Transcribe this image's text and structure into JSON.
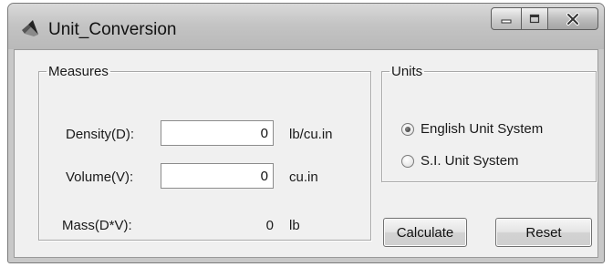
{
  "window": {
    "title": "Unit_Conversion"
  },
  "measures": {
    "legend": "Measures",
    "density": {
      "label": "Density(D):",
      "value": "0",
      "unit": "lb/cu.in"
    },
    "volume": {
      "label": "Volume(V):",
      "value": "0",
      "unit": "cu.in"
    },
    "mass": {
      "label": "Mass(D*V):",
      "value": "0",
      "unit": "lb"
    }
  },
  "units": {
    "legend": "Units",
    "options": [
      {
        "label": "English Unit System",
        "selected": true
      },
      {
        "label": "S.I. Unit System",
        "selected": false
      }
    ]
  },
  "buttons": {
    "calculate": "Calculate",
    "reset": "Reset"
  },
  "icons": {
    "app": "matlab-logo-icon",
    "minimize": "minimize-icon",
    "maximize": "maximize-icon",
    "close": "close-icon"
  }
}
